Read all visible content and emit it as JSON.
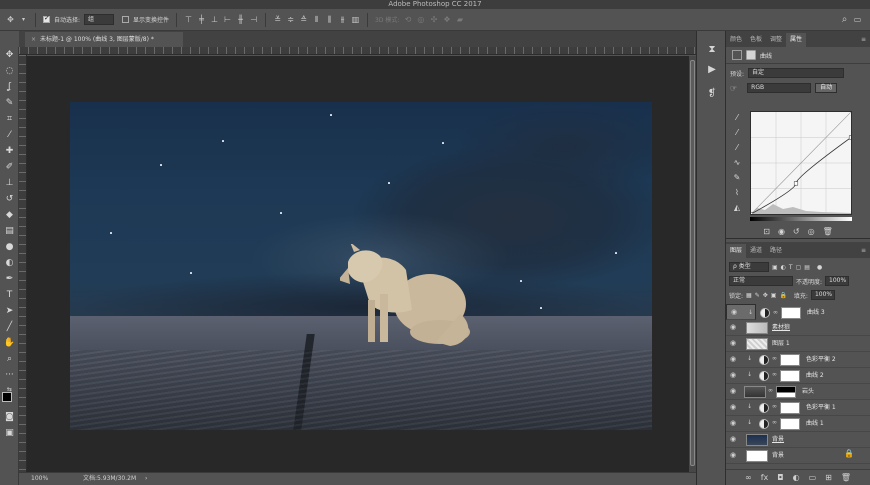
{
  "window": {
    "title": "Adobe Photoshop CC 2017"
  },
  "options_bar": {
    "auto_select_label": "自动选择:",
    "auto_select_value": "组",
    "show_transform_label": "显示变换控件",
    "mode_3d_label": "3D 模式:"
  },
  "document": {
    "tab_title": "未标题-1 @ 100% (曲线 3, 图层蒙版/8) *",
    "close_glyph": "×",
    "zoom": "100%",
    "doc_info": "文档:5.93M/30.2M"
  },
  "panels_top": {
    "tabs": [
      "颜色",
      "色板",
      "调整",
      "属性"
    ],
    "active_tab": "属性",
    "header_label": "曲线",
    "preset_label": "预设:",
    "preset_value": "自定",
    "channel_value": "RGB",
    "auto_button": "自动"
  },
  "curve": {
    "points": [
      [
        0,
        0
      ],
      [
        0.5,
        0.5
      ],
      [
        1,
        1
      ]
    ],
    "adjusted": [
      [
        0,
        0
      ],
      [
        0.45,
        0.3
      ],
      [
        1,
        0.75
      ]
    ]
  },
  "layers_panel": {
    "tabs": [
      "图层",
      "通道",
      "路径"
    ],
    "active_tab": "图层",
    "filter_value": "ρ 类型",
    "blend_mode": "正常",
    "opacity_label": "不透明度:",
    "opacity_value": "100%",
    "lock_label": "锁定:",
    "fill_label": "填充:",
    "fill_value": "100%",
    "layers": [
      {
        "name": "曲线 3",
        "kind": "adjustment",
        "clip": true,
        "selected": true
      },
      {
        "name": "素材狼",
        "kind": "pixel",
        "clip": false,
        "selected": false
      },
      {
        "name": "图层 1",
        "kind": "pixel",
        "clip": false,
        "selected": false
      },
      {
        "name": "色彩平衡 2",
        "kind": "adjustment",
        "clip": true,
        "selected": false
      },
      {
        "name": "曲线 2",
        "kind": "adjustment",
        "clip": true,
        "selected": false
      },
      {
        "name": "岩头",
        "kind": "masked-pixel",
        "clip": false,
        "selected": false
      },
      {
        "name": "色彩平衡 1",
        "kind": "adjustment",
        "clip": true,
        "selected": false
      },
      {
        "name": "曲线 1",
        "kind": "adjustment",
        "clip": true,
        "selected": false
      },
      {
        "name": "背景",
        "kind": "pixel",
        "clip": false,
        "selected": false
      },
      {
        "name": "背景",
        "kind": "background",
        "clip": false,
        "selected": false
      }
    ]
  },
  "colors": {
    "ui_bg": "#535353",
    "dark_bg": "#3d3d3d",
    "pasteboard": "#282828",
    "sky": "#1d3955"
  }
}
